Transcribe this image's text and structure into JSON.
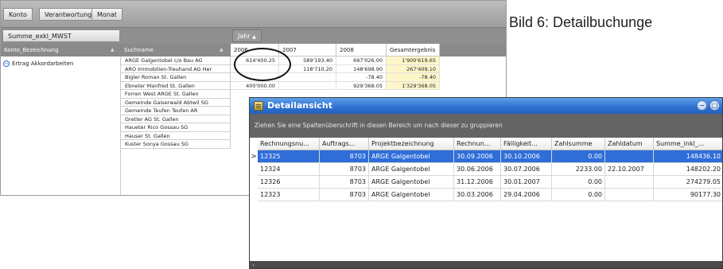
{
  "pivot": {
    "toolbar_fields": [
      "Konto",
      "Verantwortung",
      "Monat"
    ],
    "data_field": "Summe_exkl_MWST",
    "column_field": "Jahr",
    "row_fields": [
      "Konto_Bezeichnung",
      "Suchname"
    ],
    "sort_glyph": "▲",
    "year_headers": [
      "2006",
      "2007",
      "2008",
      "Gesamtergebnis"
    ],
    "konto": "Ertrag Akkordarbeiten",
    "konto_toggle": "−",
    "rows": [
      {
        "name": "ARGE Galgentobel c/o Bau AG",
        "values": [
          "614'400.25",
          "589'193.40",
          "697'026.00",
          "1'900'619.65"
        ]
      },
      {
        "name": "ARO Immobilien-Treuhand AG Her",
        "values": [
          "",
          "118'710.20",
          "148'698.90",
          "267'409.10"
        ]
      },
      {
        "name": "Bigler Roman St. Gallen",
        "values": [
          "",
          "",
          "-78.40",
          "-78.40"
        ]
      },
      {
        "name": "Ebneter Manfred St. Gallen",
        "values": [
          "400'000.00",
          "",
          "929'368.05",
          "1'329'368.05"
        ]
      },
      {
        "name": "Forren West ARGE St. Gallen",
        "values": [
          "",
          "",
          "",
          ""
        ]
      },
      {
        "name": "Gemeinde Gaiserwald Abtwil SG",
        "values": [
          "",
          "",
          "",
          ""
        ]
      },
      {
        "name": "Gemeinde Teufen Teufen AR",
        "values": [
          "",
          "",
          "",
          ""
        ]
      },
      {
        "name": "Gretler AG St. Gallen",
        "values": [
          "",
          "",
          "",
          ""
        ]
      },
      {
        "name": "Haueter Rico Gossau SG",
        "values": [
          "",
          "",
          "",
          ""
        ]
      },
      {
        "name": "Hauser St. Gallen",
        "values": [
          "",
          "",
          "",
          ""
        ]
      },
      {
        "name": "Kuster Sonya Gossau SG",
        "values": [
          "",
          "",
          "",
          ""
        ]
      }
    ]
  },
  "caption": "Bild 6:  Detailbuchunge",
  "detail": {
    "title": "Detailansicht",
    "window_buttons": [
      "−",
      "□",
      "×"
    ],
    "group_hint": "Ziehen Sie eine Spaltenüberschrift in diesen Bereich um nach dieser zu gruppieren",
    "row_indicator": ">",
    "columns": [
      "Rechnungsnu...",
      "Auftrags...",
      "Projektbezeichnung",
      "Rechnun...",
      "Fälligkeit...",
      "Zahlsumme",
      "Zahldatum",
      "Summe_inkl_..."
    ],
    "rows": [
      [
        "12325",
        "8703",
        "ARGE Galgentobel",
        "30.09.2006",
        "30.10.2006",
        "0.00",
        "",
        "148436.10"
      ],
      [
        "12324",
        "8703",
        "ARGE Galgentobel",
        "30.06.2006",
        "30.07.2006",
        "2233.00",
        "22.10.2007",
        "148202.20"
      ],
      [
        "12326",
        "8703",
        "ARGE Galgentobel",
        "31.12.2006",
        "30.01.2007",
        "0.00",
        "",
        "274279.05"
      ],
      [
        "12323",
        "8703",
        "ARGE Galgentobel",
        "30.03.2006",
        "29.04.2006",
        "0.00",
        "",
        "90177.30"
      ]
    ],
    "bottom_glyph": "‹"
  }
}
